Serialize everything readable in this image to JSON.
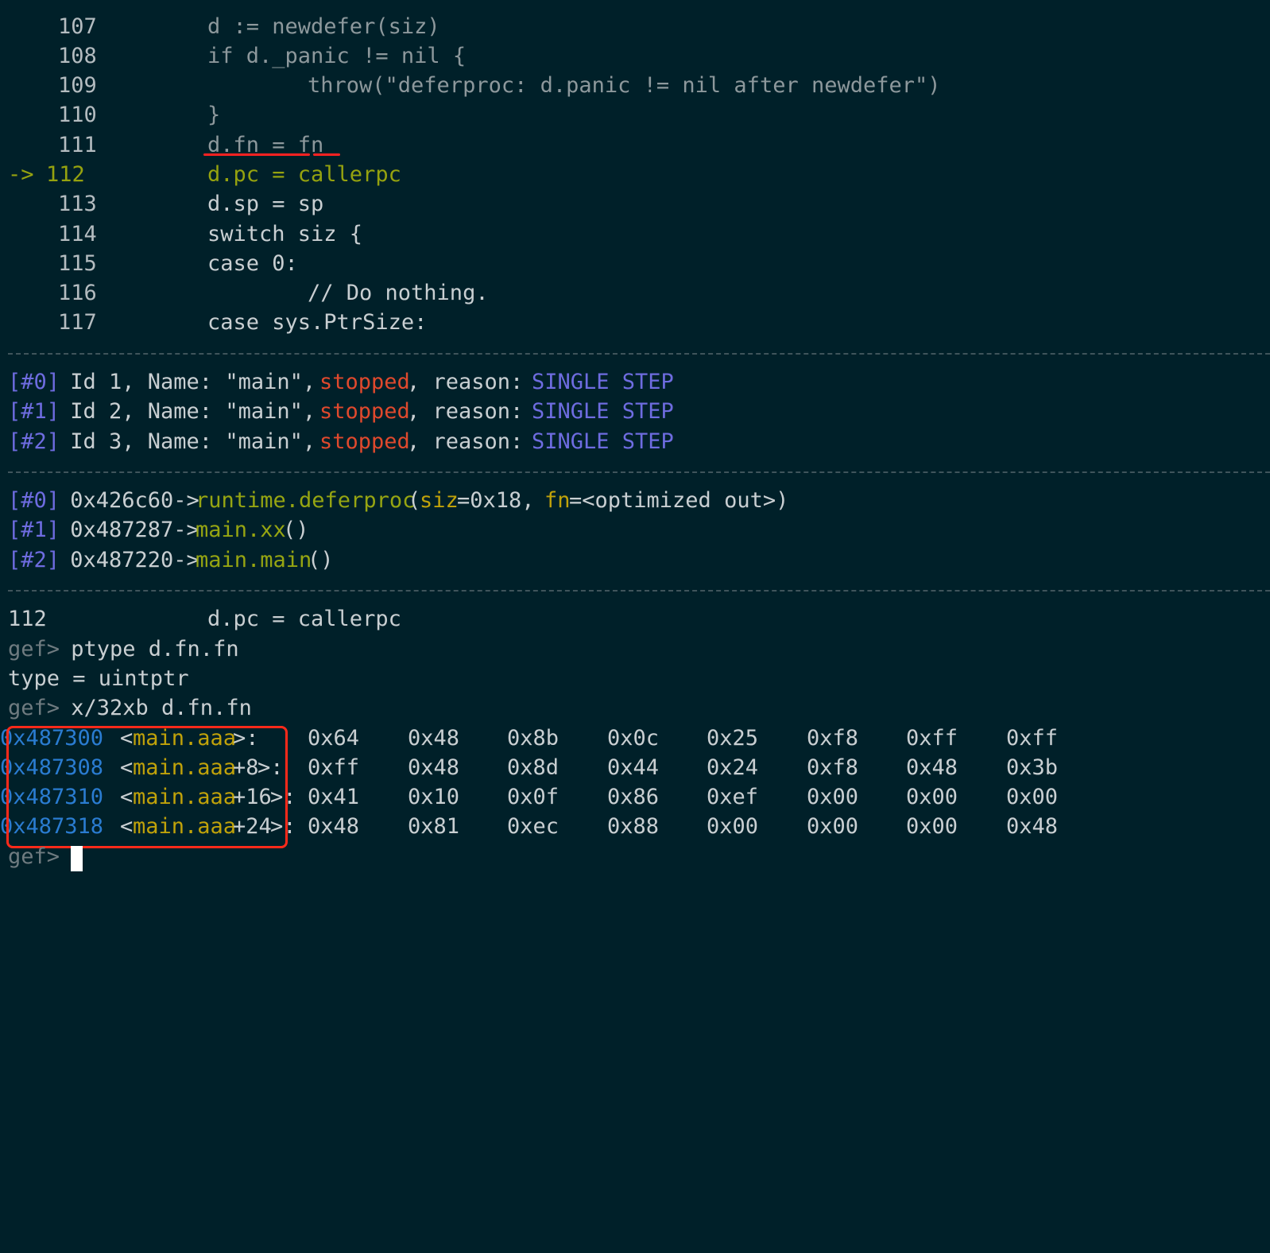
{
  "source": {
    "lines": [
      {
        "num": "107",
        "code": "d := newdefer(siz)"
      },
      {
        "num": "108",
        "code": "if d._panic != nil {"
      },
      {
        "num": "109",
        "code": "throw(\"deferproc: d.panic != nil after newdefer\")"
      },
      {
        "num": "110",
        "code": "}"
      },
      {
        "num": "111",
        "code": "d.fn = fn"
      },
      {
        "num": "112",
        "code": "d.pc = callerpc",
        "arrow": "->"
      },
      {
        "num": "113",
        "code": "d.sp = sp"
      },
      {
        "num": "114",
        "code": "switch siz {"
      },
      {
        "num": "115",
        "code": "case 0:"
      },
      {
        "num": "116",
        "code": "// Do nothing."
      },
      {
        "num": "117",
        "code": "case sys.PtrSize:"
      }
    ]
  },
  "threads": [
    {
      "idx": "[#0]",
      "text": " Id 1, Name: \"main\", ",
      "state": "stopped",
      "reason_label": ", reason: ",
      "reason": "SINGLE STEP"
    },
    {
      "idx": "[#1]",
      "text": " Id 2, Name: \"main\", ",
      "state": "stopped",
      "reason_label": ", reason: ",
      "reason": "SINGLE STEP"
    },
    {
      "idx": "[#2]",
      "text": " Id 3, Name: \"main\", ",
      "state": "stopped",
      "reason_label": ", reason: ",
      "reason": "SINGLE STEP"
    }
  ],
  "trace": [
    {
      "idx": "[#0]",
      "addr": " 0x426c60->",
      "func": "runtime.deferproc",
      "open": "(",
      "arg1": "siz",
      "val1": "=0x18, ",
      "arg2": "fn",
      "val2": "=<optimized out>)"
    },
    {
      "idx": "[#1]",
      "addr": " 0x487287->",
      "func": "main.xx",
      "open": "()"
    },
    {
      "idx": "[#2]",
      "addr": " 0x487220->",
      "func": "main.main",
      "open": "()"
    }
  ],
  "console": {
    "current_line": {
      "num": "112",
      "code": "d.pc = callerpc"
    },
    "prompt": "gef>",
    "cmd1": " ptype d.fn.fn",
    "out1": "type = uintptr",
    "cmd2": " x/32xb d.fn.fn",
    "mem": [
      {
        "addr": "0x487300",
        "sym": "main.aaa",
        "off": "",
        "suffix": ">:",
        "bytes": [
          "0x64",
          "0x48",
          "0x8b",
          "0x0c",
          "0x25",
          "0xf8",
          "0xff",
          "0xff"
        ]
      },
      {
        "addr": "0x487308",
        "sym": "main.aaa",
        "off": "+8",
        "suffix": ">:",
        "bytes": [
          "0xff",
          "0x48",
          "0x8d",
          "0x44",
          "0x24",
          "0xf8",
          "0x48",
          "0x3b"
        ]
      },
      {
        "addr": "0x487310",
        "sym": "main.aaa",
        "off": "+16",
        "suffix": ">:",
        "bytes": [
          "0x41",
          "0x10",
          "0x0f",
          "0x86",
          "0xef",
          "0x00",
          "0x00",
          "0x00"
        ]
      },
      {
        "addr": "0x487318",
        "sym": "main.aaa",
        "off": "+24",
        "suffix": ">:",
        "bytes": [
          "0x48",
          "0x81",
          "0xec",
          "0x88",
          "0x00",
          "0x00",
          "0x00",
          "0x48"
        ]
      }
    ],
    "final_prompt": "gef>"
  },
  "colors": {
    "background": "#002029",
    "current_line": "#95a20f",
    "highlight_box": "#ff2a1a"
  }
}
